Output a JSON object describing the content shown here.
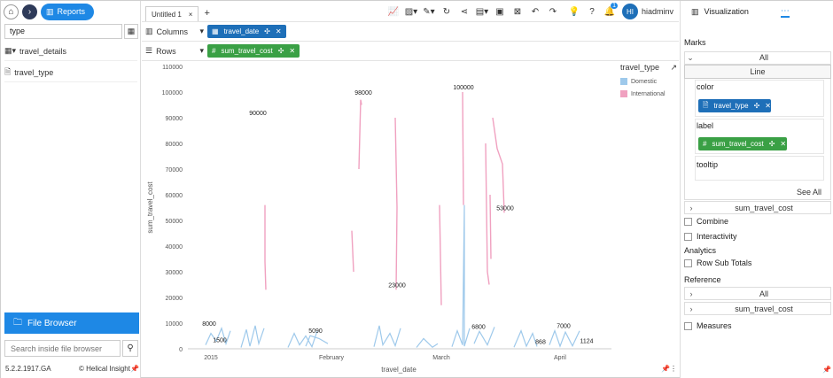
{
  "nav": {
    "reports_label": "Reports"
  },
  "left": {
    "search_value": "type",
    "tree": [
      {
        "label": "travel_details"
      },
      {
        "label": "travel_type"
      }
    ],
    "file_browser_label": "File Browser",
    "file_search_placeholder": "Search inside file browser",
    "version": "5.2.2.1917.GA",
    "brand": "Helical Insight"
  },
  "tabs": [
    {
      "label": "Untitled 1"
    }
  ],
  "user": {
    "initials": "HI",
    "name": "hiadminv",
    "notifications": "1"
  },
  "shelves": {
    "columns_label": "Columns",
    "columns_pill": "travel_date",
    "rows_label": "Rows",
    "rows_pill": "sum_travel_cost"
  },
  "legend": {
    "title": "travel_type",
    "items": [
      {
        "label": "Domestic",
        "color": "#9ec9eb"
      },
      {
        "label": "International",
        "color": "#f0a1c0"
      }
    ]
  },
  "right": {
    "tab_label": "Visualization",
    "marks_label": "Marks",
    "all_label": "All",
    "line_label": "Line",
    "color_label": "color",
    "color_pill": "travel_type",
    "label_label": "label",
    "label_pill": "sum_travel_cost",
    "tooltip_label": "tooltip",
    "see_all": "See All",
    "field_row": "sum_travel_cost",
    "combine": "Combine",
    "interactivity": "Interactivity",
    "analytics": "Analytics",
    "row_sub_totals": "Row Sub Totals",
    "reference": "Reference",
    "ref_all": "All",
    "ref_field": "sum_travel_cost",
    "measures": "Measures"
  },
  "chart_data": {
    "type": "line",
    "xlabel": "travel_date",
    "ylabel": "sum_travel_cost",
    "ylim": [
      0,
      110000
    ],
    "yticks": [
      "0",
      "10000",
      "20000",
      "30000",
      "40000",
      "50000",
      "60000",
      "70000",
      "80000",
      "90000",
      "100000",
      "110000"
    ],
    "xticks": [
      "2015",
      "February",
      "March",
      "April"
    ],
    "series": [
      {
        "name": "Domestic",
        "color": "#9ec9eb"
      },
      {
        "name": "International",
        "color": "#f0a1c0"
      }
    ],
    "annotations": [
      {
        "text": "8000",
        "x": "2015",
        "y": 8000
      },
      {
        "text": "1500",
        "x": "2015",
        "y": 1500
      },
      {
        "text": "90000",
        "x": "January",
        "y": 90000
      },
      {
        "text": "5090",
        "x": "February",
        "y": 5090
      },
      {
        "text": "98000",
        "x": "February",
        "y": 98000
      },
      {
        "text": "23000",
        "x": "February",
        "y": 23000
      },
      {
        "text": "100000",
        "x": "March",
        "y": 100000
      },
      {
        "text": "6800",
        "x": "March",
        "y": 6800
      },
      {
        "text": "53000",
        "x": "March",
        "y": 53000
      },
      {
        "text": "868",
        "x": "April",
        "y": 868
      },
      {
        "text": "7000",
        "x": "April",
        "y": 7000
      },
      {
        "text": "1124",
        "x": "April",
        "y": 1124
      }
    ]
  }
}
